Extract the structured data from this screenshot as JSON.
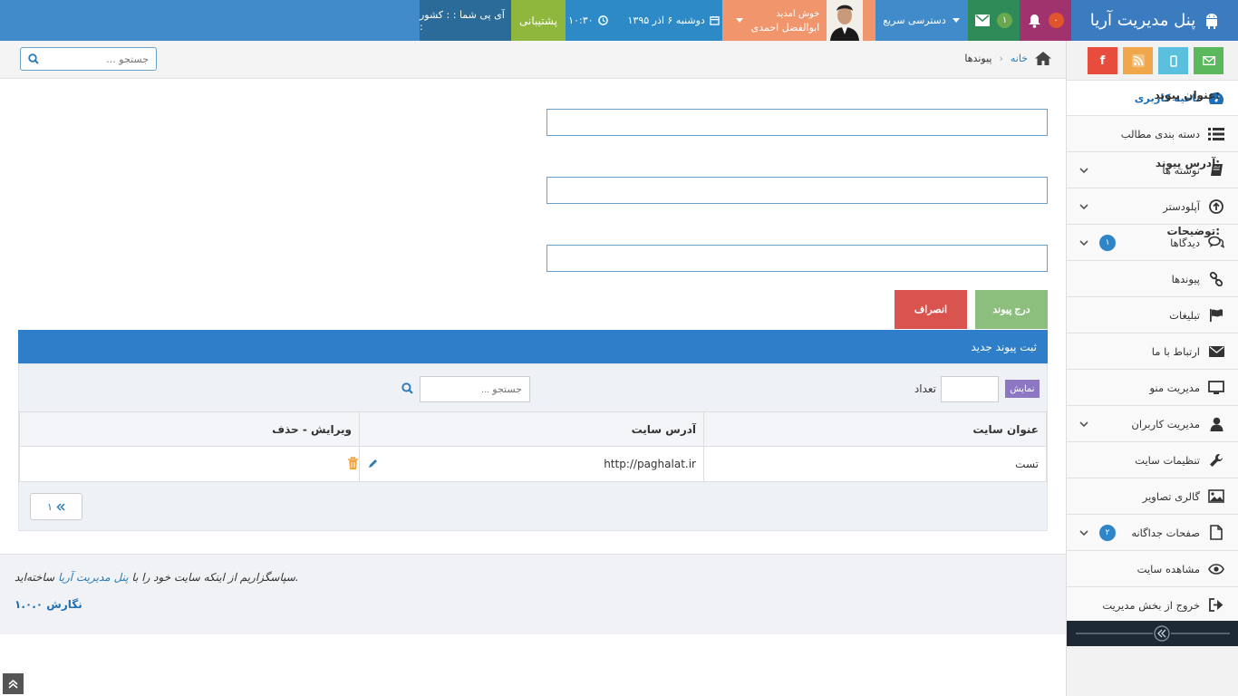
{
  "header": {
    "brand": "پنل مدیریت آریا",
    "notifications_count": "۰",
    "messages_count": "۱",
    "quick_access": "دسترسی سریع",
    "welcome": "خوش امدید",
    "user_name": "ابوالفضل احمدی",
    "date": "دوشنبه ۶ اذر ۱۳۹۵",
    "time": "۱۰:۳۰",
    "support": "پشتیبانی",
    "ip_info": "آی پی شما : : کشور :",
    "colors": {
      "brand": "#3b7bbf",
      "notif": "#a0336e",
      "mail": "#2e8b57",
      "user": "#f0956c",
      "support": "#8fb73e"
    }
  },
  "social": {
    "icons": [
      "mail-icon",
      "mobile-icon",
      "rss-icon",
      "facebook-icon"
    ]
  },
  "sidebar": {
    "items": [
      {
        "label": "ناحیه کاربری",
        "icon": "dashboard-icon"
      },
      {
        "label": "دسته بندی مطالب",
        "icon": "list-icon"
      },
      {
        "label": "نوشته ها",
        "icon": "book-icon"
      },
      {
        "label": "آپلودستر",
        "icon": "upload-icon"
      },
      {
        "label": "دیدگاها",
        "icon": "comments-icon",
        "count": "۱"
      },
      {
        "label": "پیوندها",
        "icon": "link-icon"
      },
      {
        "label": "تبلیغات",
        "icon": "flag-icon"
      },
      {
        "label": "ارتباط با ما",
        "icon": "envelope-icon"
      },
      {
        "label": "مدیریت منو",
        "icon": "monitor-icon"
      },
      {
        "label": "مدیریت کاربران",
        "icon": "user-icon"
      },
      {
        "label": "تنظیمات سایت",
        "icon": "wrench-icon"
      },
      {
        "label": "گالری تصاویر",
        "icon": "image-icon"
      },
      {
        "label": "صفحات جداگانه",
        "icon": "file-icon",
        "count": "۲"
      },
      {
        "label": "مشاهده سایت",
        "icon": "eye-icon"
      },
      {
        "label": "خروج از بخش مدیریت",
        "icon": "signout-icon"
      }
    ]
  },
  "breadcrumb": {
    "home": "خانه",
    "current": "پیوندها"
  },
  "top_search": {
    "placeholder": "جستجو ..."
  },
  "form": {
    "title_label": "عنوان پیوند:",
    "url_label": "آدرس پیوند:",
    "desc_label": "توضیحات:",
    "submit": "درج پیوند",
    "cancel": "انصراف"
  },
  "panel": {
    "title": "ثبت پیوند جدید",
    "show_label": "نمایش",
    "count_label": "تعداد",
    "search_placeholder": "جستجو ...",
    "columns": [
      "عنوان سایت",
      "آدرس سایت",
      "ویرایش - حذف"
    ],
    "rows": [
      {
        "title": "تست",
        "url": "http://paghalat.ir"
      }
    ],
    "page": "۱"
  },
  "footer": {
    "thanks_pre": ".سپاسگزاریم از اینکه سایت خود را با ",
    "thanks_link": "پنل مدیریت آریا",
    "thanks_post": " ساخته‌اید",
    "version": "نگارش ۱.۰.۰"
  }
}
